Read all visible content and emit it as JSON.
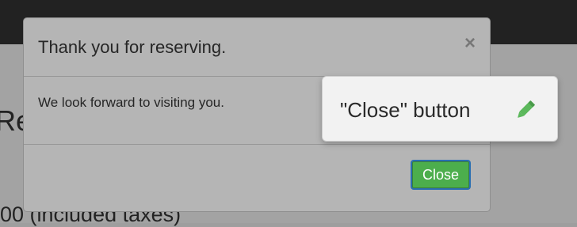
{
  "background": {
    "fragment_1": "Re",
    "fragment_2": "00 (included taxes)"
  },
  "modal": {
    "title": "Thank you for reserving.",
    "close_icon": "×",
    "body_text": "We look forward to visiting you.",
    "close_button_label": "Close"
  },
  "tooltip": {
    "text": "\"Close\" button",
    "icon": "pencil-icon"
  },
  "colors": {
    "button_green": "#4cae4c",
    "button_focus_border": "#2b6fb2",
    "pencil_green": "#5cb85c",
    "topbar": "#222222"
  }
}
